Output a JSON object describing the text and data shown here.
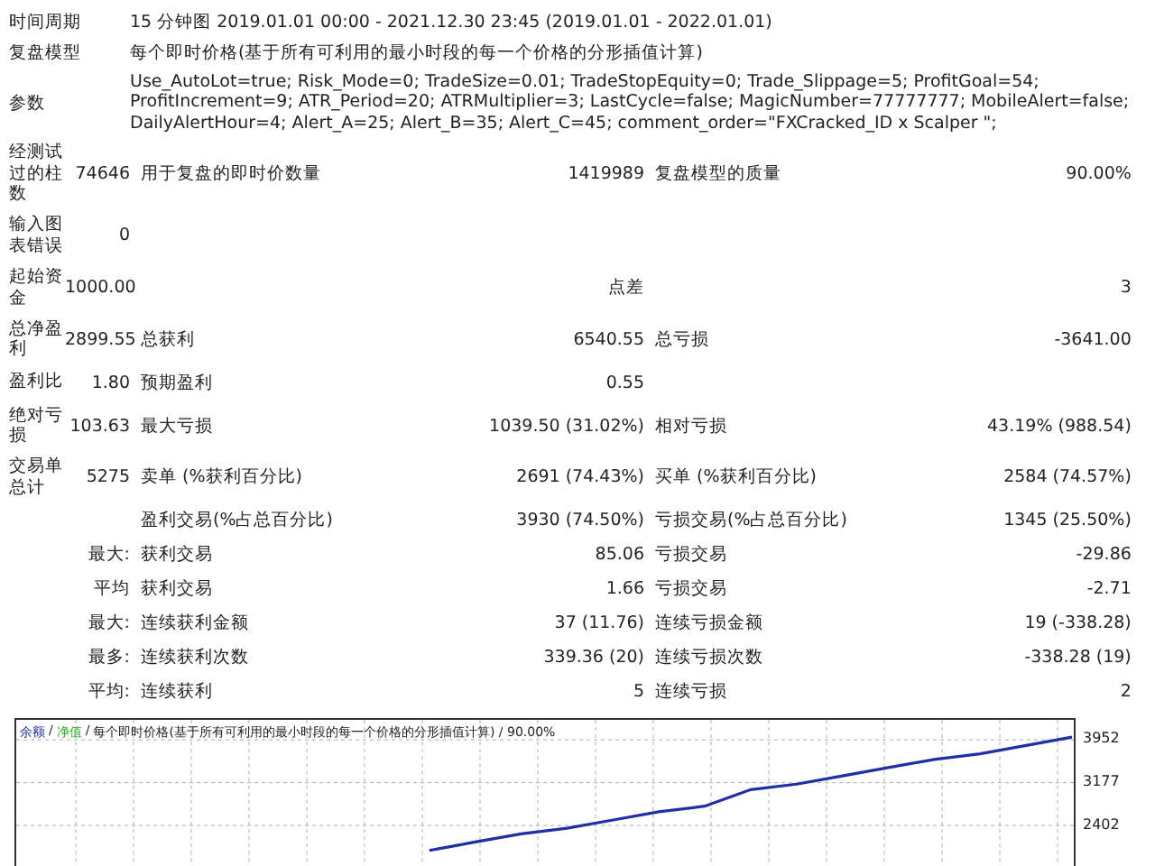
{
  "info": [
    {
      "label": "时间周期",
      "value": "15 分钟图 2019.01.01 00:00 - 2021.12.30 23:45 (2019.01.01 - 2022.01.01)"
    },
    {
      "label": "复盘模型",
      "value": "每个即时价格(基于所有可利用的最小时段的每一个价格的分形插值计算)"
    },
    {
      "label": "参数",
      "value": "Use_AutoLot=true; Risk_Mode=0; TradeSize=0.01; TradeStopEquity=0; Trade_Slippage=5; ProfitGoal=54; ProfitIncrement=9; ATR_Period=20; ATRMultiplier=3; LastCycle=false; MagicNumber=77777777; MobileAlert=false; DailyAlertHour=4; Alert_A=25; Alert_B=35; Alert_C=45; comment_order=\"FXCracked_ID x Scalper \";"
    }
  ],
  "stats": [
    {
      "kind": "main",
      "label": "经测试过的柱数",
      "value": "74646",
      "items": [
        {
          "label": "用于复盘的即时价数量",
          "value": "1419989"
        },
        {
          "label": "复盘模型的质量",
          "value": "90.00%"
        }
      ]
    },
    {
      "kind": "main",
      "label": "输入图表错误",
      "value": "0"
    },
    {
      "kind": "main",
      "label": "起始资金",
      "value": "1000.00",
      "items": [
        {
          "value": "点差"
        },
        {
          "value": "3"
        }
      ]
    },
    {
      "kind": "main",
      "label": "总净盈利",
      "value": "2899.55",
      "items": [
        {
          "label": "总获利",
          "value": "6540.55"
        },
        {
          "label": "总亏损",
          "value": "-3641.00"
        }
      ]
    },
    {
      "kind": "main",
      "label": "盈利比",
      "value": "1.80",
      "items": [
        {
          "label": "预期盈利",
          "value": "0.55"
        }
      ]
    },
    {
      "kind": "main",
      "label": "绝对亏损",
      "value": "103.63",
      "items": [
        {
          "label": "最大亏损",
          "value": "1039.50 (31.02%)"
        },
        {
          "label": "相对亏损",
          "value": "43.19% (988.54)"
        }
      ]
    },
    {
      "kind": "main",
      "label": "交易单总计",
      "value": "5275",
      "items": [
        {
          "label": "卖单 (%获利百分比)",
          "value": "2691 (74.43%)"
        },
        {
          "label": "买单 (%获利百分比)",
          "value": "2584 (74.57%)"
        }
      ]
    },
    {
      "kind": "sub",
      "items": [
        {
          "label": "盈利交易(%占总百分比)",
          "value": "3930 (74.50%)"
        },
        {
          "label": "亏损交易(%占总百分比)",
          "value": "1345 (25.50%)"
        }
      ]
    },
    {
      "kind": "sub",
      "prefix": "最大:",
      "items": [
        {
          "label": "获利交易",
          "value": "85.06"
        },
        {
          "label": "亏损交易",
          "value": "-29.86"
        }
      ]
    },
    {
      "kind": "sub",
      "prefix": "平均",
      "items": [
        {
          "label": "获利交易",
          "value": "1.66"
        },
        {
          "label": "亏损交易",
          "value": "-2.71"
        }
      ]
    },
    {
      "kind": "sub",
      "prefix": "最大:",
      "items": [
        {
          "label": "连续获利金额",
          "value": "37 (11.76)"
        },
        {
          "label": "连续亏损金额",
          "value": "19 (-338.28)"
        }
      ]
    },
    {
      "kind": "sub",
      "prefix": "最多:",
      "items": [
        {
          "label": "连续获利次数",
          "value": "339.36 (20)"
        },
        {
          "label": "连续亏损次数",
          "value": "-338.28 (19)"
        }
      ]
    },
    {
      "kind": "sub",
      "prefix": "平均:",
      "items": [
        {
          "label": "连续获利",
          "value": "5"
        },
        {
          "label": "连续亏损",
          "value": "2"
        }
      ]
    }
  ],
  "chart": {
    "legend": [
      {
        "text": "净值",
        "color": "#22b422"
      }
    ],
    "separator": "/",
    "caption": "每个即时价格(基于所有可利用的最小时段的每一个价格的分形插值计算) / 90.00%",
    "chart_data": {
      "type": "line",
      "grid": true,
      "ylim": [
        1675,
        4315
      ],
      "yticks": [
        2402,
        3177,
        3952
      ],
      "series": [
        {
          "name": "余额",
          "color": "#1f2fa8",
          "values": [
            null,
            null,
            null,
            null,
            null,
            null,
            null,
            null,
            null,
            1950,
            2100,
            2250,
            2350,
            2500,
            2650,
            2750,
            3050,
            3150,
            3300,
            3450,
            3600,
            3700,
            3850,
            4000
          ]
        }
      ]
    }
  }
}
